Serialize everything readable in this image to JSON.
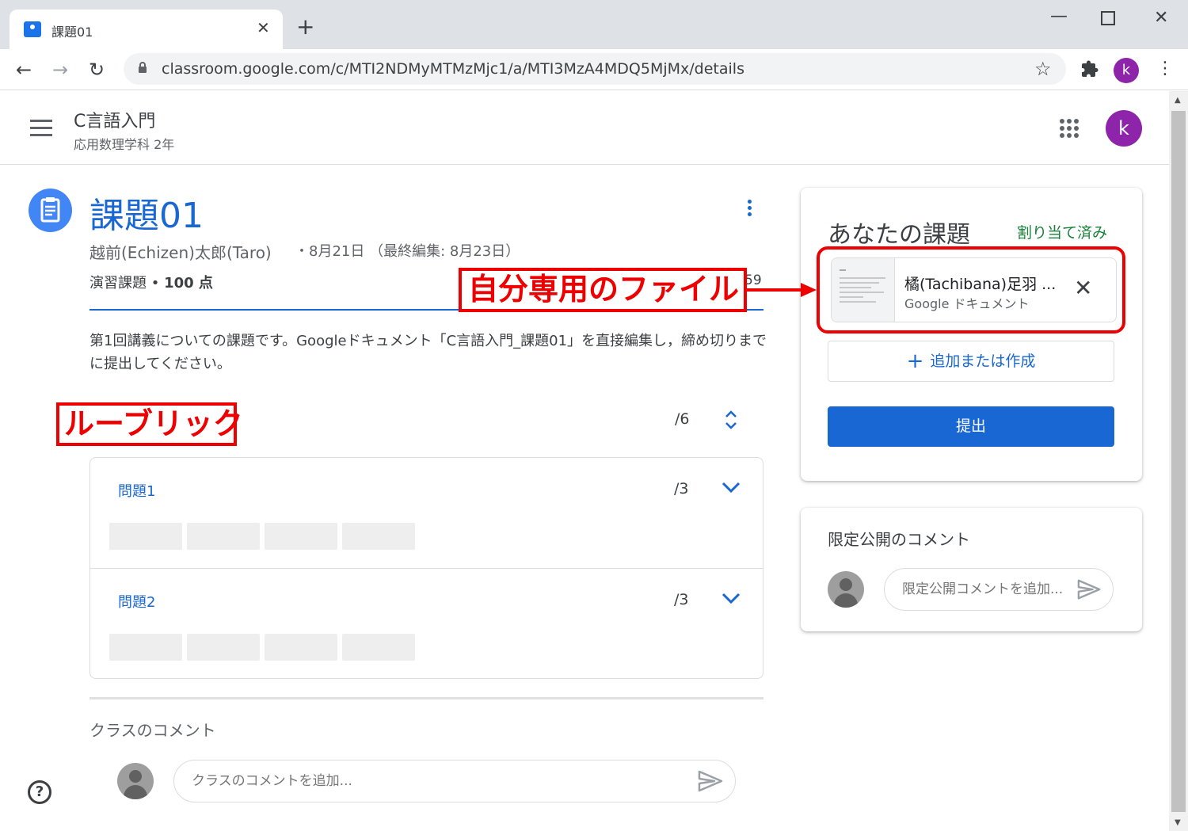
{
  "browser": {
    "tab_title": "課題01",
    "url": "classroom.google.com/c/MTI2NDMyMTMzMjc1/a/MTI3MzA4MDQ5MjMx/details",
    "profile_initial": "k"
  },
  "header": {
    "course_name": "C言語入門",
    "section": "応用数理学科 2年",
    "avatar_initial": "k"
  },
  "assignment": {
    "title": "課題01",
    "author": "越前(Echizen)太郎(Taro)",
    "meta": "・8月21日 （最終編集: 8月23日）",
    "type_label": "演習課題 • ",
    "points": "100 点",
    "due_fragment": "59",
    "description": "第1回講義についての課題です。Googleドキュメント「C言語入門_課題01」を直接編集し，締め切りまでに提出してください。"
  },
  "rubric": {
    "annotation": "ルーブリック",
    "total": "/6",
    "criteria": [
      {
        "name": "問題1",
        "points": "/3"
      },
      {
        "name": "問題2",
        "points": "/3"
      }
    ]
  },
  "class_comments": {
    "title": "クラスのコメント",
    "placeholder": "クラスのコメントを追加..."
  },
  "your_work": {
    "title": "あなたの課題",
    "status": "割り当て済み",
    "file_name": "橘(Tachibana)足羽 ...",
    "file_type": "Google ドキュメント",
    "add_button": "追加または作成",
    "add_icon": "+",
    "submit_button": "提出"
  },
  "private_comments": {
    "title": "限定公開のコメント",
    "placeholder": "限定公開コメントを追加..."
  },
  "annotation": {
    "label": "自分専用のファイル"
  },
  "colors": {
    "accent": "#1967d2",
    "annotation": "#ee0000",
    "status": "#188038"
  }
}
